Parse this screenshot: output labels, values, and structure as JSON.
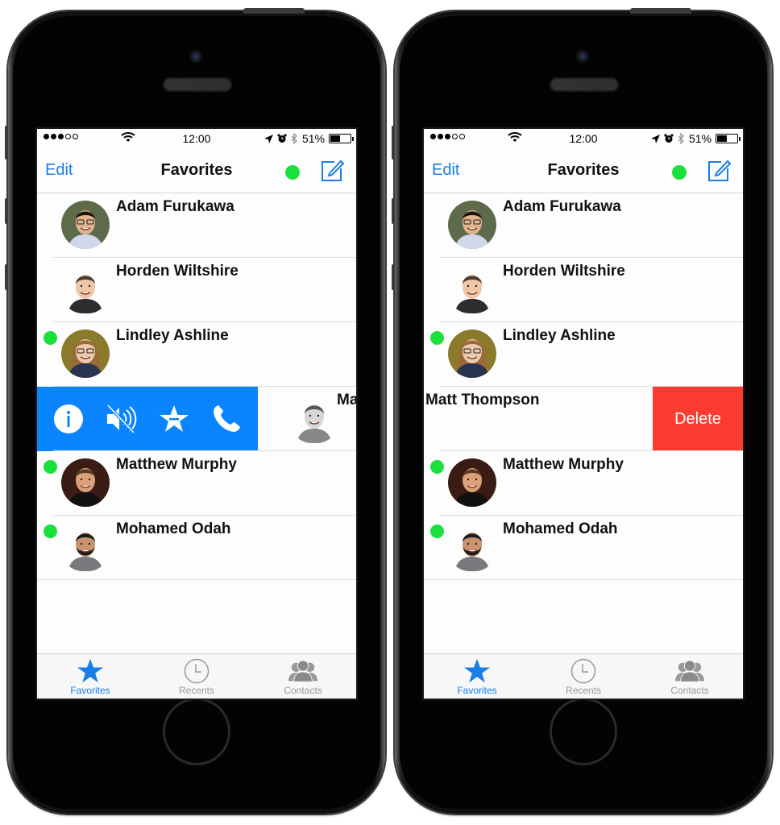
{
  "colors": {
    "accent": "#1a7ee6",
    "online": "#19e03b",
    "action_blue": "#0a84ff",
    "delete_red": "#fb3a30",
    "tab_inactive": "#9a9a9a"
  },
  "phones": [
    {
      "status": {
        "carrier_signal": "3 of 5",
        "time": "12:00",
        "battery": "51%",
        "battery_level": 0.51,
        "icons": [
          "location-icon",
          "alarm-icon",
          "bluetooth-icon"
        ]
      },
      "nav": {
        "edit_label": "Edit",
        "title": "Favorites",
        "compose_icon": "compose-icon"
      },
      "contacts": [
        {
          "name": "Adam Furukawa",
          "online": false
        },
        {
          "name": "Horden Wiltshire",
          "online": false
        },
        {
          "name": "Lindley Ashline",
          "online": true
        },
        {
          "name": "Matt Thompson",
          "visible_name": "Ma",
          "online": false,
          "state": "swiped-right",
          "actions": [
            "info-icon",
            "mute-icon",
            "unfavorite-icon",
            "phone-icon"
          ]
        },
        {
          "name": "Matthew Murphy",
          "online": true
        },
        {
          "name": "Mohamed Odah",
          "online": true
        }
      ],
      "tabs": [
        {
          "label": "Favorites",
          "icon": "star-icon",
          "active": true
        },
        {
          "label": "Recents",
          "icon": "clock-icon",
          "active": false
        },
        {
          "label": "Contacts",
          "icon": "contacts-icon",
          "active": false
        }
      ]
    },
    {
      "status": {
        "carrier_signal": "3 of 5",
        "time": "12:00",
        "battery": "51%",
        "battery_level": 0.51,
        "icons": [
          "location-icon",
          "alarm-icon",
          "bluetooth-icon"
        ]
      },
      "nav": {
        "edit_label": "Edit",
        "title": "Favorites",
        "compose_icon": "compose-icon"
      },
      "contacts": [
        {
          "name": "Adam Furukawa",
          "online": false
        },
        {
          "name": "Horden Wiltshire",
          "online": false
        },
        {
          "name": "Lindley Ashline",
          "online": true
        },
        {
          "name": "Matt Thompson",
          "visible_name": "latt Thompson",
          "online": false,
          "state": "swiped-left",
          "delete_label": "Delete"
        },
        {
          "name": "Matthew Murphy",
          "online": true
        },
        {
          "name": "Mohamed Odah",
          "online": true
        }
      ],
      "tabs": [
        {
          "label": "Favorites",
          "icon": "star-icon",
          "active": true
        },
        {
          "label": "Recents",
          "icon": "clock-icon",
          "active": false
        },
        {
          "label": "Contacts",
          "icon": "contacts-icon",
          "active": false
        }
      ]
    }
  ]
}
